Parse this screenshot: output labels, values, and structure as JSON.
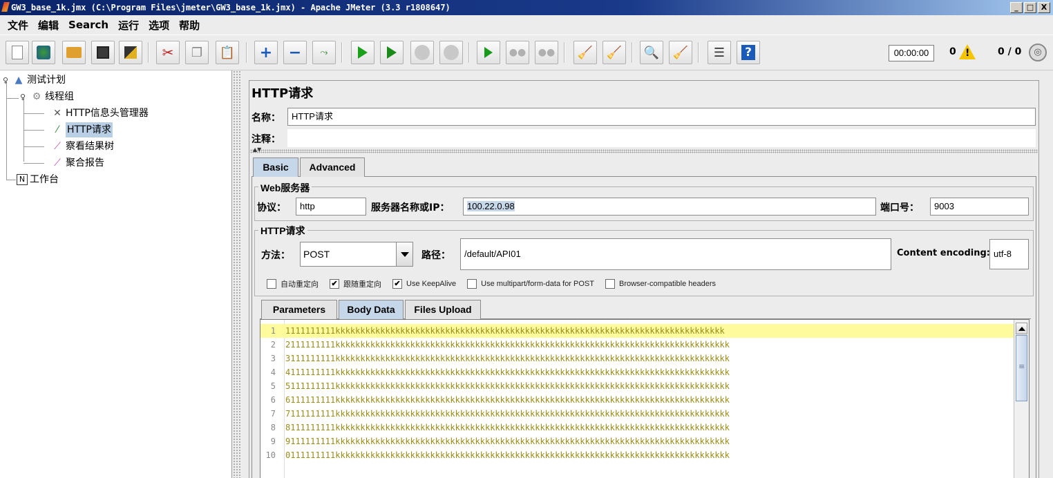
{
  "window": {
    "title": "GW3_base_1k.jmx (C:\\Program Files\\jmeter\\GW3_base_1k.jmx) - Apache JMeter (3.3 r1808647)",
    "minimize": "_",
    "maximize": "□",
    "close": "X"
  },
  "menu": [
    "文件",
    "编辑",
    "Search",
    "运行",
    "选项",
    "帮助"
  ],
  "toolbar": {
    "icons": [
      "new-icon",
      "templates-icon",
      "open-icon",
      "save-icon",
      "save-as-icon",
      "cut-icon",
      "copy-icon",
      "paste-icon",
      "expand-icon",
      "collapse-icon",
      "toggle-icon",
      "start-icon",
      "start-no-pauses-icon",
      "stop-icon",
      "shutdown-icon",
      "remote-start-icon",
      "remote-stop-icon",
      "remote-shutdown-icon",
      "clear-icon",
      "clear-all-icon",
      "search-icon",
      "reset-search-icon",
      "function-helper-icon",
      "help-icon"
    ],
    "timer": "00:00:00",
    "warnings": "0",
    "threads": "0 / 0"
  },
  "tree": {
    "nodes": [
      {
        "label": "测试计划",
        "icon": "test-plan-icon"
      },
      {
        "label": "线程组",
        "icon": "thread-group-icon"
      },
      {
        "label": "HTTP信息头管理器",
        "icon": "header-manager-icon"
      },
      {
        "label": "HTTP请求",
        "icon": "http-sampler-icon"
      },
      {
        "label": "察看结果树",
        "icon": "results-tree-icon"
      },
      {
        "label": "聚合报告",
        "icon": "aggregate-report-icon"
      },
      {
        "label": "工作台",
        "icon": "workbench-icon"
      }
    ]
  },
  "form": {
    "title": "HTTP请求",
    "name_label": "名称：",
    "name_value": "HTTP请求",
    "comment_label": "注释：",
    "comment_value": "",
    "tabs": [
      "Basic",
      "Advanced"
    ],
    "web_server": {
      "group_title": "Web服务器",
      "protocol_label": "协议：",
      "protocol_value": "http",
      "server_label": "服务器名称或IP：",
      "server_value": "100.22.0.98",
      "port_label": "端口号：",
      "port_value": "9003"
    },
    "http_request": {
      "group_title": "HTTP请求",
      "method_label": "方法：",
      "method_value": "POST",
      "path_label": "路径：",
      "path_value": "/default/API01",
      "encoding_label": "Content encoding:",
      "encoding_value": "utf-8"
    },
    "checkboxes": [
      {
        "label": "自动重定向",
        "checked": false
      },
      {
        "label": "跟随重定向",
        "checked": true
      },
      {
        "label": "Use KeepAlive",
        "checked": true
      },
      {
        "label": "Use multipart/form-data for POST",
        "checked": false
      },
      {
        "label": "Browser-compatible headers",
        "checked": false
      }
    ],
    "body_tabs": [
      "Parameters",
      "Body Data",
      "Files Upload"
    ],
    "body_lines": [
      {
        "no": "1",
        "text": "1111111111kkkkkkkkkkkkkkkkkkkkkkkkkkkkkkkkkkkkkkkkkkkkkkkkkkkkkkkkkkkkkkkkkkkkkkkkkkkkkk"
      },
      {
        "no": "2",
        "text": "2111111111kkkkkkkkkkkkkkkkkkkkkkkkkkkkkkkkkkkkkkkkkkkkkkkkkkkkkkkkkkkkkkkkkkkkkkkkkkkkkkk"
      },
      {
        "no": "3",
        "text": "3111111111kkkkkkkkkkkkkkkkkkkkkkkkkkkkkkkkkkkkkkkkkkkkkkkkkkkkkkkkkkkkkkkkkkkkkkkkkkkkkkk"
      },
      {
        "no": "4",
        "text": "4111111111kkkkkkkkkkkkkkkkkkkkkkkkkkkkkkkkkkkkkkkkkkkkkkkkkkkkkkkkkkkkkkkkkkkkkkkkkkkkkkk"
      },
      {
        "no": "5",
        "text": "5111111111kkkkkkkkkkkkkkkkkkkkkkkkkkkkkkkkkkkkkkkkkkkkkkkkkkkkkkkkkkkkkkkkkkkkkkkkkkkkkkk"
      },
      {
        "no": "6",
        "text": "6111111111kkkkkkkkkkkkkkkkkkkkkkkkkkkkkkkkkkkkkkkkkkkkkkkkkkkkkkkkkkkkkkkkkkkkkkkkkkkkkkk"
      },
      {
        "no": "7",
        "text": "7111111111kkkkkkkkkkkkkkkkkkkkkkkkkkkkkkkkkkkkkkkkkkkkkkkkkkkkkkkkkkkkkkkkkkkkkkkkkkkkkkk"
      },
      {
        "no": "8",
        "text": "8111111111kkkkkkkkkkkkkkkkkkkkkkkkkkkkkkkkkkkkkkkkkkkkkkkkkkkkkkkkkkkkkkkkkkkkkkkkkkkkkkk"
      },
      {
        "no": "9",
        "text": "9111111111kkkkkkkkkkkkkkkkkkkkkkkkkkkkkkkkkkkkkkkkkkkkkkkkkkkkkkkkkkkkkkkkkkkkkkkkkkkkkkk"
      },
      {
        "no": "10",
        "text": "0111111111kkkkkkkkkkkkkkkkkkkkkkkkkkkkkkkkkkkkkkkkkkkkkkkkkkkkkkkkkkkkkkkkkkkkkkkkkkkkkkk"
      }
    ]
  },
  "colors": {
    "titlebar": "#0a246a",
    "selection": "#b8cfe5",
    "active_tab": "#c6d7ea",
    "current_line": "#fdfb9c",
    "code_text": "#9a8c19"
  }
}
